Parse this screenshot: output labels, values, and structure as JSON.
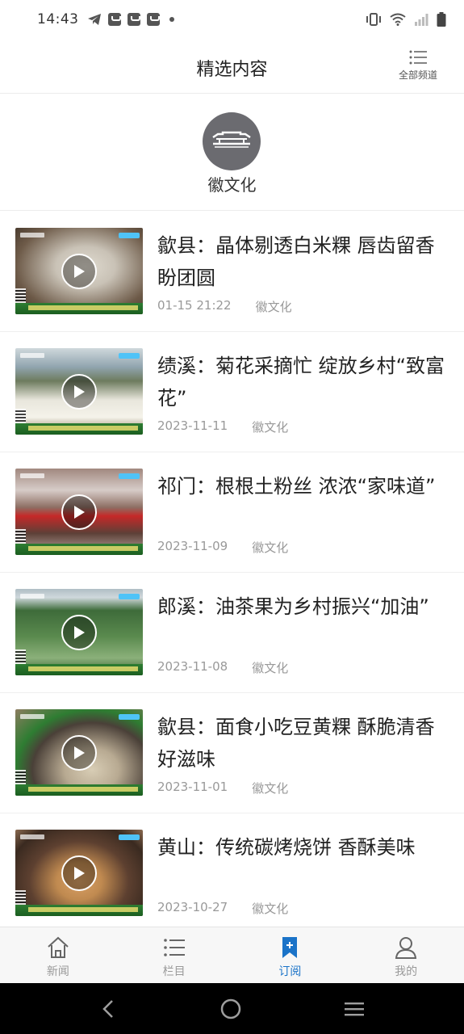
{
  "status_bar": {
    "time": "14:43",
    "icons": [
      "telegram-icon",
      "notification-icon",
      "notification-icon",
      "notification-icon",
      "dot-icon",
      "vibrate-icon",
      "wifi-icon",
      "signal-icon",
      "battery-icon"
    ]
  },
  "header": {
    "title": "精选内容",
    "all_channels_label": "全部频道"
  },
  "channel": {
    "name": "徽文化",
    "icon": "hui-architecture-icon"
  },
  "news": [
    {
      "title": "歙县：晶体剔透白米粿 唇齿留香盼团圆",
      "date": "01-15 21:22",
      "source": "徽文化",
      "thumb_colors": [
        "#6d5a48",
        "#c9c2b6"
      ]
    },
    {
      "title": "绩溪：菊花采摘忙 绽放乡村“致富花”",
      "date": "2023-11-11",
      "source": "徽文化",
      "thumb_colors": [
        "#7a8a6a",
        "#e8e6dc"
      ]
    },
    {
      "title": "祁门：根根土粉丝 浓浓“家味道”",
      "date": "2023-11-09",
      "source": "徽文化",
      "thumb_colors": [
        "#8d6e63",
        "#d7ccc8"
      ]
    },
    {
      "title": "郎溪：油茶果为乡村振兴“加油”",
      "date": "2023-11-08",
      "source": "徽文化",
      "thumb_colors": [
        "#3e6b3a",
        "#8bb07a"
      ]
    },
    {
      "title": "歙县：面食小吃豆黄粿 酥脆清香好滋味",
      "date": "2023-11-01",
      "source": "徽文化",
      "thumb_colors": [
        "#4a4038",
        "#b8aa92"
      ]
    },
    {
      "title": "黄山：传统碳烤烧饼 香酥美味",
      "date": "2023-10-27",
      "source": "徽文化",
      "thumb_colors": [
        "#5d4030",
        "#c08a50"
      ]
    }
  ],
  "bottom_nav": [
    {
      "label": "新闻",
      "icon": "home-icon",
      "active": false
    },
    {
      "label": "栏目",
      "icon": "list-icon",
      "active": false
    },
    {
      "label": "订阅",
      "icon": "bookmark-icon",
      "active": true
    },
    {
      "label": "我的",
      "icon": "user-icon",
      "active": false
    }
  ],
  "colors": {
    "accent": "#1a73c8",
    "meta": "#999999"
  }
}
